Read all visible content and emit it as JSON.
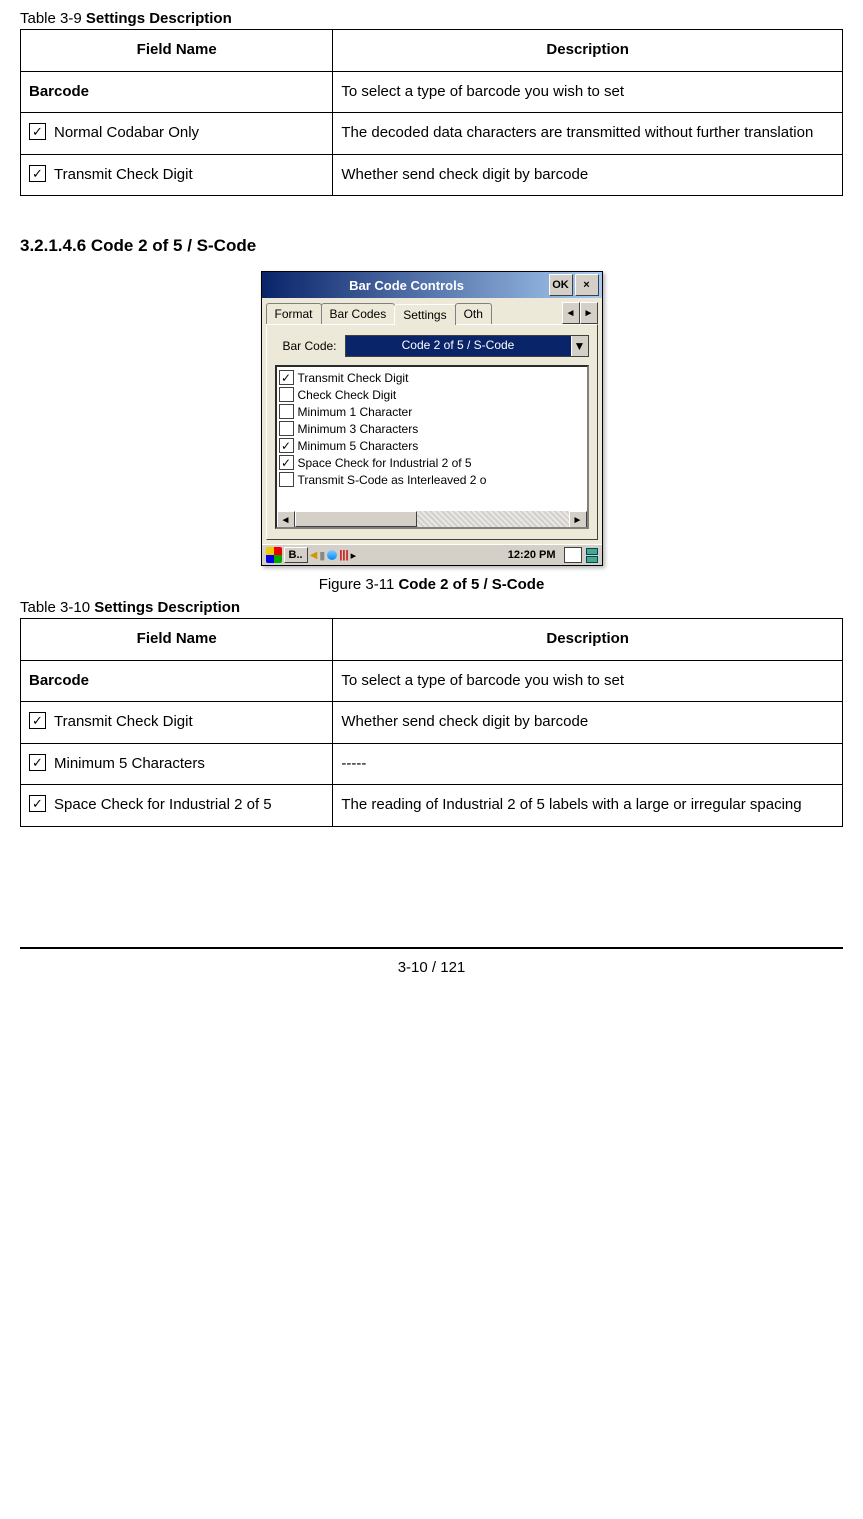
{
  "table9": {
    "caption_prefix": "Table 3-9 ",
    "caption_bold": "Settings Description",
    "headers": {
      "field": "Field Name",
      "desc": "Description"
    },
    "rows": [
      {
        "field": "Barcode",
        "field_bold": true,
        "has_checkbox": false,
        "desc": "To select a type of barcode you wish to set"
      },
      {
        "field": "Normal Codabar Only",
        "has_checkbox": true,
        "desc": "The decoded data characters are transmitted without further translation"
      },
      {
        "field": "Transmit Check Digit",
        "has_checkbox": true,
        "desc": "Whether send check digit by barcode"
      }
    ]
  },
  "section_heading": "3.2.1.4.6 Code 2 of 5 / S-Code",
  "dialog": {
    "title": "Bar Code Controls",
    "ok": "OK",
    "close": "×",
    "tabs": {
      "t1": "Format",
      "t2": "Bar Codes",
      "t3": "Settings",
      "t4": "Oth"
    },
    "tab_left": "◄",
    "tab_right": "►",
    "barcode_label": "Bar Code:",
    "barcode_value": "Code 2 of 5 / S-Code",
    "dd": "▼",
    "items": [
      {
        "checked": true,
        "label": "Transmit Check Digit"
      },
      {
        "checked": false,
        "label": "Check Check Digit"
      },
      {
        "checked": false,
        "label": "Minimum 1 Character"
      },
      {
        "checked": false,
        "label": "Minimum 3 Characters"
      },
      {
        "checked": true,
        "label": "Minimum 5 Characters"
      },
      {
        "checked": true,
        "label": "Space Check for Industrial 2 of 5"
      },
      {
        "checked": false,
        "label": "Transmit S-Code as Interleaved 2 o"
      }
    ],
    "hs_left": "◄",
    "hs_right": "►",
    "taskbar": {
      "task": "B..",
      "time": "12:20 PM",
      "sep": "▸"
    }
  },
  "figure11": {
    "prefix": "Figure 3-11 ",
    "bold": "Code 2 of 5 / S-Code"
  },
  "table10": {
    "caption_prefix": "Table 3-10 ",
    "caption_bold": "Settings Description",
    "headers": {
      "field": "Field Name",
      "desc": "Description"
    },
    "rows": [
      {
        "field": "Barcode",
        "field_bold": true,
        "has_checkbox": false,
        "desc": "To select a type of barcode you wish to set"
      },
      {
        "field": "Transmit Check Digit",
        "has_checkbox": true,
        "desc": "Whether send check digit by barcode"
      },
      {
        "field": "Minimum 5 Characters",
        "has_checkbox": true,
        "desc": "-----"
      },
      {
        "field": "Space Check for Industrial 2 of 5",
        "has_checkbox": true,
        "desc": "The reading of Industrial 2 of 5 labels with a large or irregular spacing"
      }
    ]
  },
  "page_number": "3-10 / 121",
  "check_glyph": "✓"
}
